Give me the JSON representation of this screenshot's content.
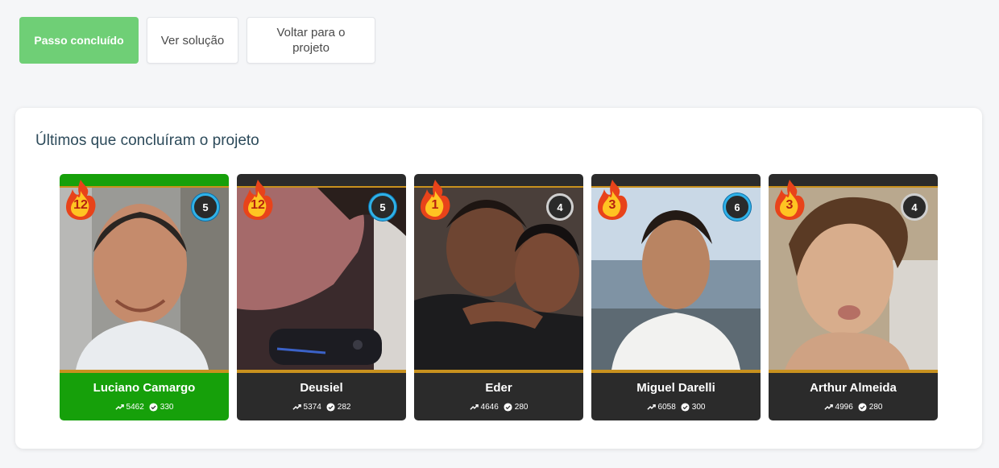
{
  "buttons": {
    "done": "Passo concluído",
    "solution": "Ver solução",
    "back": "Voltar para o projeto"
  },
  "panel": {
    "title": "Últimos que concluíram o projeto"
  },
  "cards": [
    {
      "name": "Luciano Camargo",
      "streak": "12",
      "level": "5",
      "xp": "5462",
      "done": "330"
    },
    {
      "name": "Deusiel",
      "streak": "12",
      "level": "5",
      "xp": "5374",
      "done": "282"
    },
    {
      "name": "Eder",
      "streak": "1",
      "level": "4",
      "xp": "4646",
      "done": "280"
    },
    {
      "name": "Miguel Darelli",
      "streak": "3",
      "level": "6",
      "xp": "6058",
      "done": "300"
    },
    {
      "name": "Arthur Almeida",
      "streak": "3",
      "level": "4",
      "xp": "4996",
      "done": "280"
    }
  ],
  "colors": {
    "done_button": "#6fcf76",
    "top_card": "#16a00a",
    "card": "#2b2b2b",
    "gold": "#c8911e",
    "title": "#2c4a5a"
  }
}
